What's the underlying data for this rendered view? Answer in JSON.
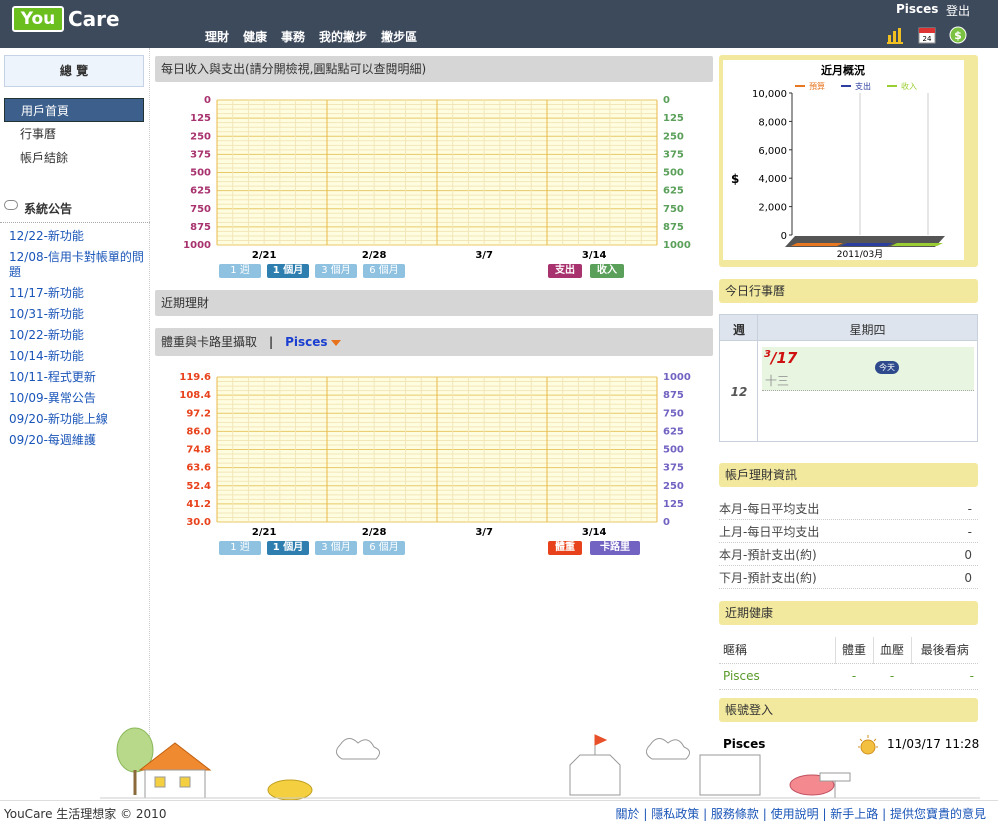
{
  "header": {
    "logo_you": "You",
    "logo_care": "Care",
    "nav": [
      "理財",
      "健康",
      "事務",
      "我的撇步",
      "撇步區"
    ],
    "user": "Pisces",
    "logout": "登出",
    "calendar_icon_day": "24",
    "money_icon": "$"
  },
  "sidebar": {
    "overview": "總 覽",
    "menu": [
      "用戶首頁",
      "行事曆",
      "帳戶結餘"
    ],
    "announce_title": "系統公告",
    "announcements": [
      "12/22-新功能",
      "12/08-信用卡對帳單的問題",
      "11/17-新功能",
      "10/31-新功能",
      "10/22-新功能",
      "10/14-新功能",
      "10/11-程式更新",
      "10/09-異常公告",
      "09/20-新功能上線",
      "09/20-每週維護"
    ]
  },
  "panels": {
    "daily_title": "每日收入與支出(請分開檢視,圓點點可以查閱明細)",
    "recent_fin_title": "近期理財",
    "weight_title": "體重與卡路里攝取",
    "weight_user": "Pisces",
    "range_buttons": [
      "1 週",
      "1 個月",
      "3 個月",
      "6 個月"
    ],
    "expense_btn": "支出",
    "income_btn": "收入",
    "weight_btn": "體重",
    "calorie_btn": "卡路里"
  },
  "chart_data": [
    {
      "type": "line",
      "y_left": [
        "0",
        "125",
        "250",
        "375",
        "500",
        "625",
        "750",
        "875",
        "1000"
      ],
      "y_right": [
        "0",
        "125",
        "250",
        "375",
        "500",
        "625",
        "750",
        "875",
        "1000"
      ],
      "x_ticks": [
        "2/21",
        "2/28",
        "3/7",
        "3/14"
      ],
      "ylim": [
        1000,
        0
      ],
      "series": []
    },
    {
      "type": "line",
      "y_left": [
        "119.6",
        "108.4",
        "97.2",
        "86.0",
        "74.8",
        "63.6",
        "52.4",
        "41.2",
        "30.0"
      ],
      "y_right": [
        "1000",
        "875",
        "750",
        "625",
        "500",
        "375",
        "250",
        "125",
        "0"
      ],
      "x_ticks": [
        "2/21",
        "2/28",
        "3/7",
        "3/14"
      ],
      "series": []
    },
    {
      "type": "bar",
      "title": "近月概況",
      "legend": [
        "預算",
        "支出",
        "收入"
      ],
      "colors": [
        "#e87722",
        "#2b3fa0",
        "#9acd32"
      ],
      "y_ticks": [
        "10,000",
        "8,000",
        "6,000",
        "4,000",
        "2,000",
        "0"
      ],
      "ylabel": "$",
      "categories": [
        "2011/03月"
      ],
      "values": [
        0,
        0,
        0
      ],
      "ylim": [
        0,
        10000
      ]
    }
  ],
  "today": {
    "title": "今日行事曆",
    "week_label": "週",
    "day_label": "星期四",
    "week_num": "12",
    "date_month": "3",
    "date_day": "17",
    "lunar": "十三",
    "today_badge": "今天"
  },
  "finance": {
    "title": "帳戶理財資訊",
    "rows": [
      {
        "label": "本月-每日平均支出",
        "value": "-"
      },
      {
        "label": "上月-每日平均支出",
        "value": "-"
      },
      {
        "label": "本月-預計支出(約)",
        "value": "0"
      },
      {
        "label": "下月-預計支出(約)",
        "value": "0"
      }
    ]
  },
  "health": {
    "title": "近期健康",
    "headers": [
      "暱稱",
      "體重",
      "血壓",
      "最後看病"
    ],
    "rows": [
      [
        "Pisces",
        "-",
        "-",
        "-"
      ]
    ]
  },
  "login": {
    "title": "帳號登入",
    "user": "Pisces",
    "time": "11/03/17 11:28"
  },
  "footer": {
    "copyright": "YouCare 生活理想家 © 2010",
    "links": [
      "關於",
      "隱私政策",
      "服務條款",
      "使用說明",
      "新手上路",
      "提供您寶貴的意見"
    ]
  },
  "colors": {
    "header_bg": "#3d4a5c",
    "chart_bg": "#fffde0",
    "grid_major": "#e8b948",
    "expense": "#a8326e",
    "income": "#5aa05a",
    "weight": "#e8421c",
    "calorie": "#7262c2"
  }
}
